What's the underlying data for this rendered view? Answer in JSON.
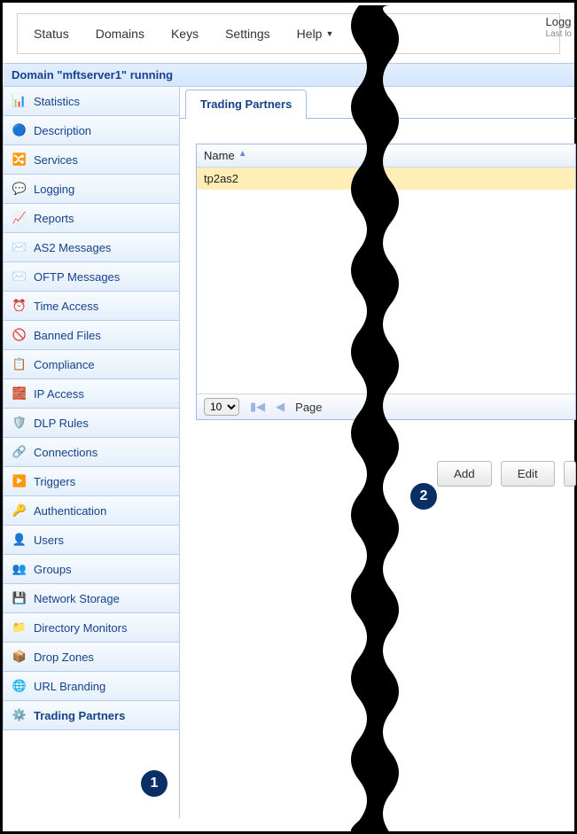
{
  "topnav": {
    "items": [
      "Status",
      "Domains",
      "Keys",
      "Settings",
      "Help"
    ]
  },
  "login": {
    "line1": "Logg",
    "line2": "Last lo"
  },
  "heading": "Domain \"mftserver1\" running",
  "sidebar": {
    "items": [
      {
        "icon": "📊",
        "label": "Statistics"
      },
      {
        "icon": "🔵",
        "label": "Description"
      },
      {
        "icon": "🔀",
        "label": "Services"
      },
      {
        "icon": "💬",
        "label": "Logging"
      },
      {
        "icon": "📈",
        "label": "Reports"
      },
      {
        "icon": "✉️",
        "label": "AS2 Messages"
      },
      {
        "icon": "✉️",
        "label": "OFTP Messages"
      },
      {
        "icon": "⏰",
        "label": "Time Access"
      },
      {
        "icon": "🚫",
        "label": "Banned Files"
      },
      {
        "icon": "📋",
        "label": "Compliance"
      },
      {
        "icon": "🧱",
        "label": "IP Access"
      },
      {
        "icon": "🛡️",
        "label": "DLP Rules"
      },
      {
        "icon": "🔗",
        "label": "Connections"
      },
      {
        "icon": "▶️",
        "label": "Triggers"
      },
      {
        "icon": "🔑",
        "label": "Authentication"
      },
      {
        "icon": "👤",
        "label": "Users"
      },
      {
        "icon": "👥",
        "label": "Groups"
      },
      {
        "icon": "💾",
        "label": "Network Storage"
      },
      {
        "icon": "📁",
        "label": "Directory Monitors"
      },
      {
        "icon": "📦",
        "label": "Drop Zones"
      },
      {
        "icon": "🌐",
        "label": "URL Branding"
      },
      {
        "icon": "⚙️",
        "label": "Trading Partners",
        "selected": true
      }
    ]
  },
  "tab": {
    "label": "Trading Partners"
  },
  "grid": {
    "header": "Name",
    "rows": [
      "tp2as2"
    ],
    "pageSize": "10",
    "pageLabel": "Page"
  },
  "buttons": {
    "add": "Add",
    "edit": "Edit"
  },
  "annotations": {
    "one": "1",
    "two": "2"
  }
}
